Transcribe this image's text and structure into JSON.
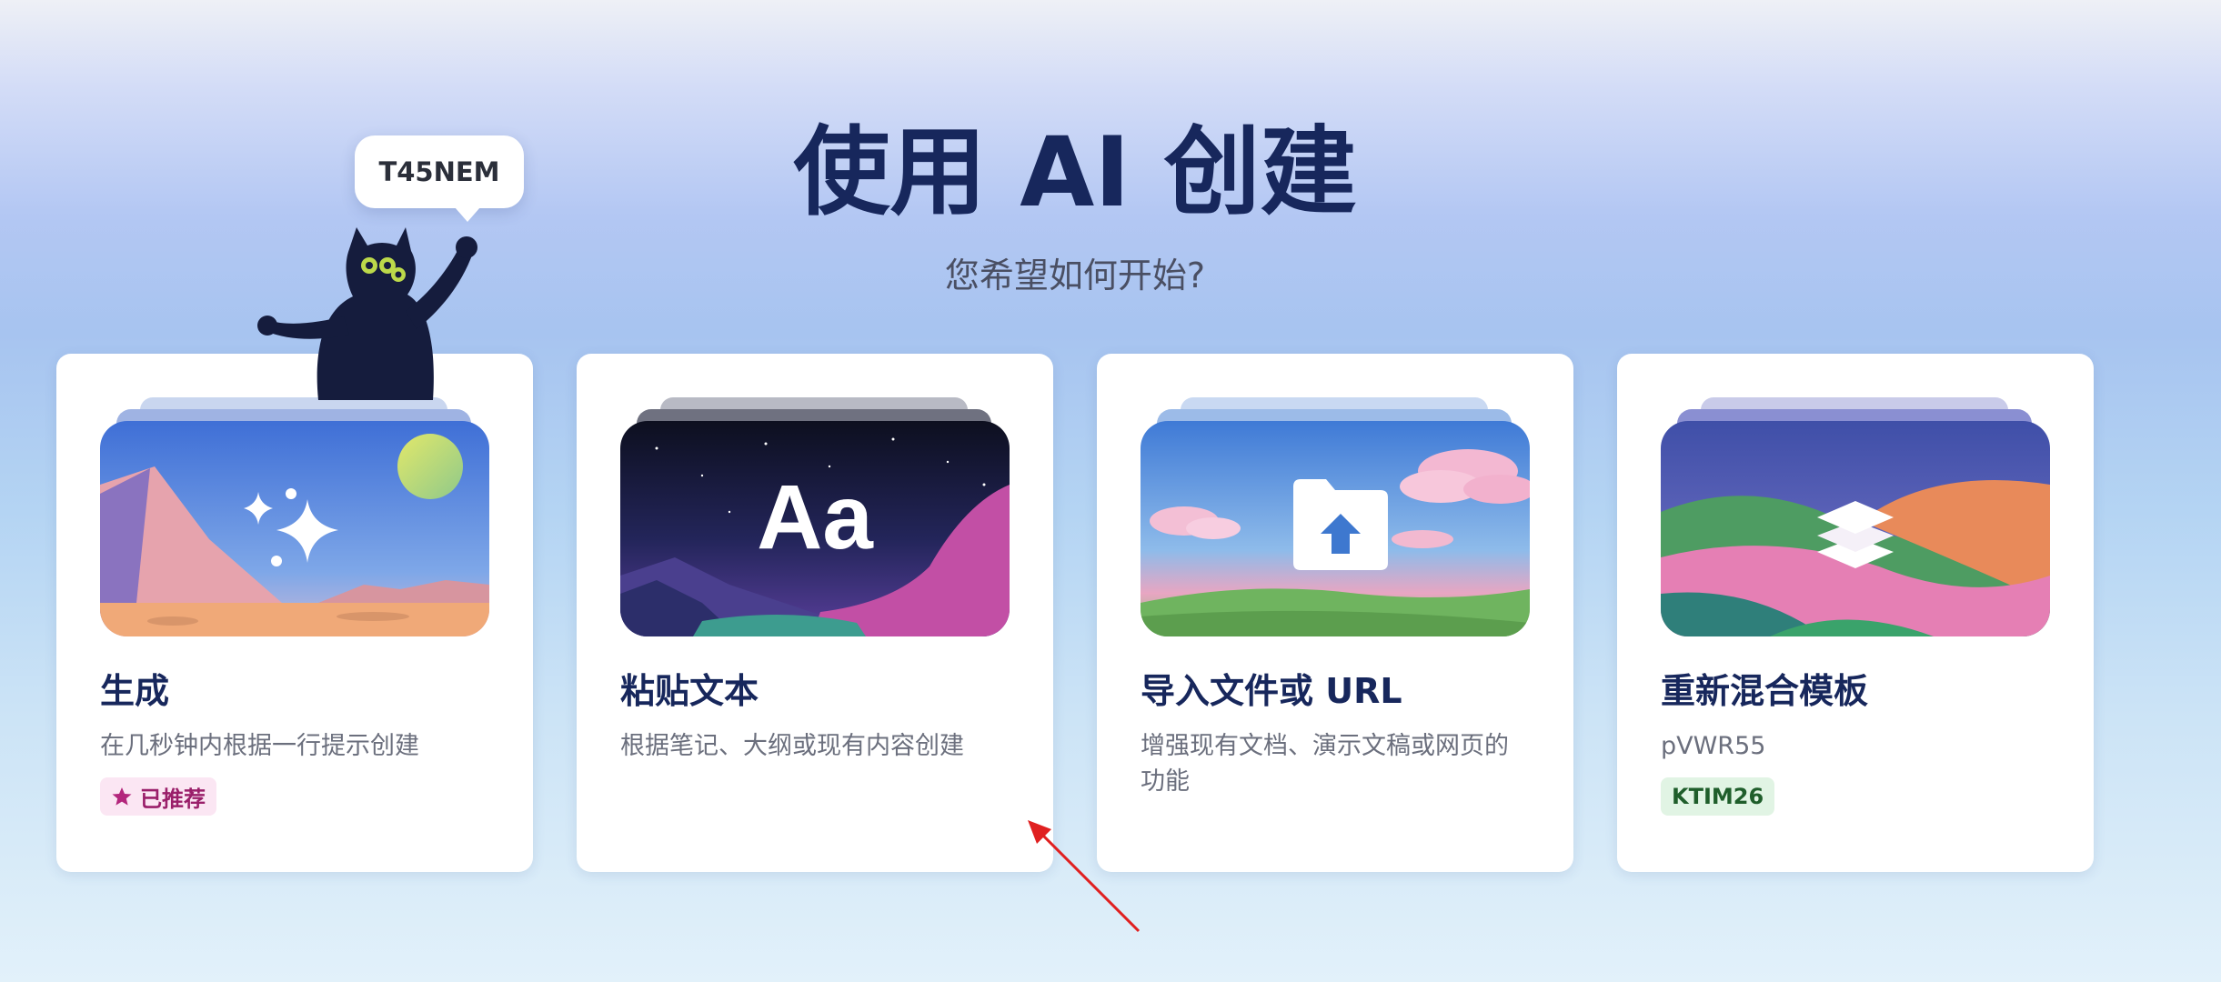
{
  "header": {
    "title": "使用 AI 创建",
    "subtitle": "您希望如何开始?"
  },
  "mascot": {
    "bubble_text": "T45NEM"
  },
  "cards": [
    {
      "title": "生成",
      "description": "在几秒钟内根据一行提示创建",
      "badge": "已推荐",
      "icon": "sparkles-icon"
    },
    {
      "title": "粘贴文本",
      "description": "根据笔记、大纲或现有内容创建",
      "icon": "text-aa-icon",
      "icon_text": "Aa"
    },
    {
      "title": "导入文件或 URL",
      "description": "增强现有文档、演示文稿或网页的功能",
      "icon": "folder-upload-icon"
    },
    {
      "title": "重新混合模板",
      "description": "pVWR55",
      "badge": "KTIM26",
      "icon": "layers-icon"
    }
  ],
  "colors": {
    "title": "#17275c",
    "recommended_badge_bg": "#fbe6f3",
    "recommended_badge_text": "#9a1f6a",
    "code_badge_bg": "#e1f4e4",
    "code_badge_text": "#1f5e2b",
    "pointer_arrow": "#e02020"
  }
}
